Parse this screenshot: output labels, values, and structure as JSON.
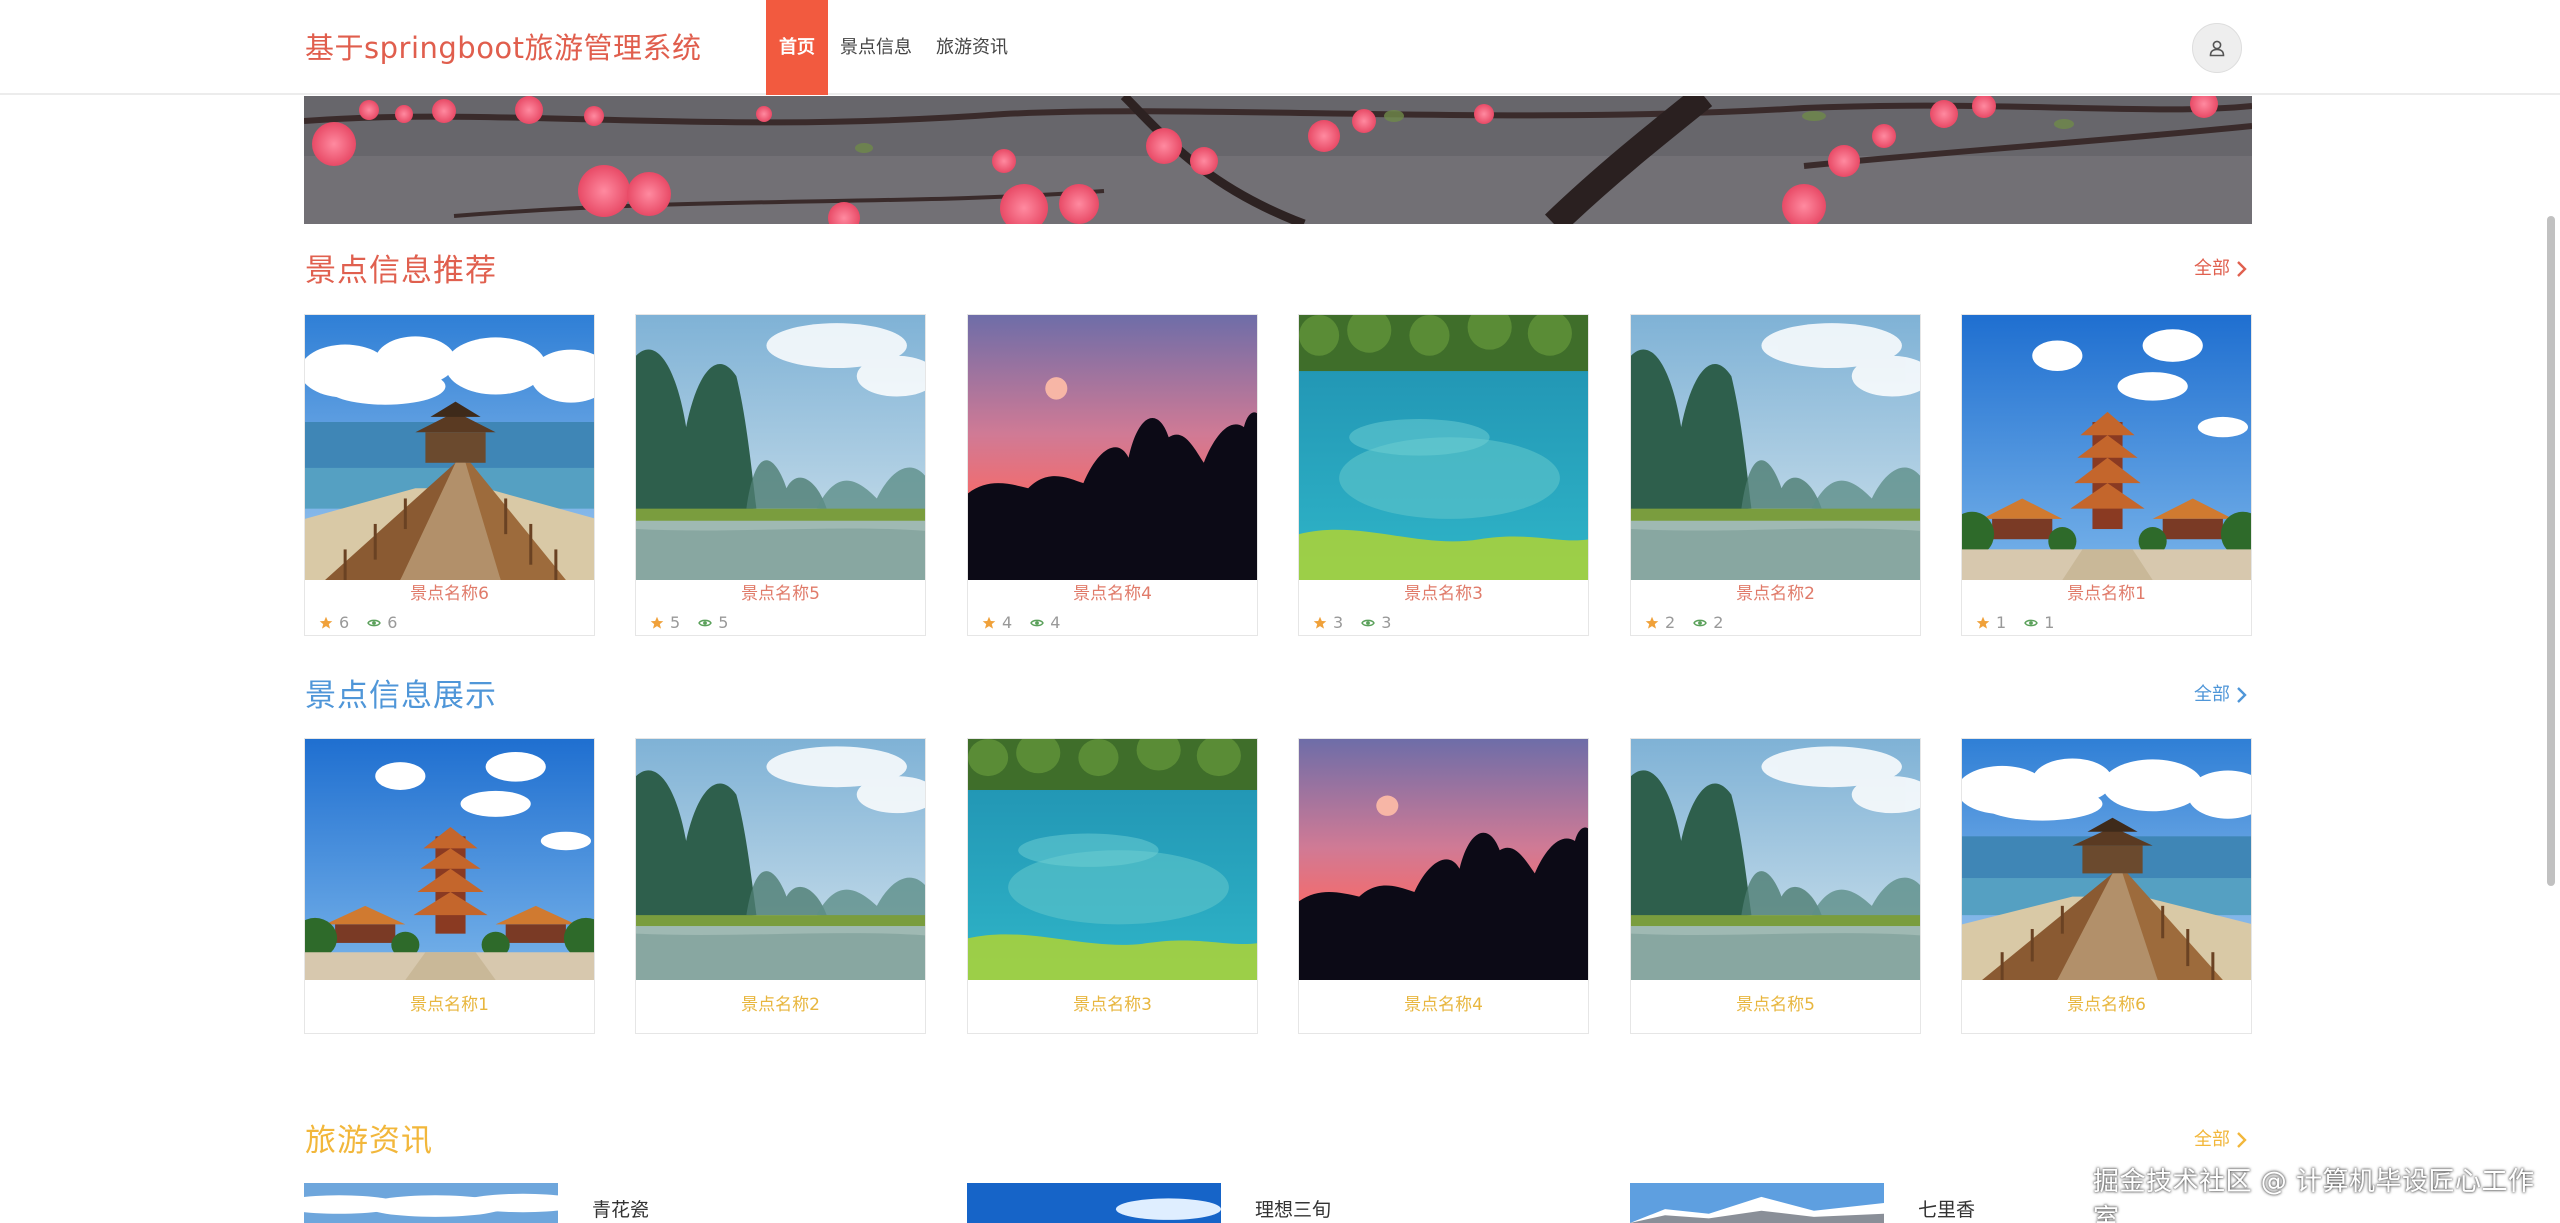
{
  "colors": {
    "brand": "#e05e4d",
    "nav_active_bg": "#f25a3f",
    "section1_title": "#e0604f",
    "section2_title": "#4f96d8",
    "section3_title": "#f2b73b",
    "card1_name": "#e07b6a",
    "card2_name": "#e8b63e",
    "star": "#f0a13a",
    "eye": "#5aa05a"
  },
  "header": {
    "title": "基于springboot旅游管理系统",
    "nav": [
      {
        "label": "首页"
      },
      {
        "label": "景点信息"
      },
      {
        "label": "旅游资讯"
      }
    ],
    "avatar_icon": "user-icon"
  },
  "recommend": {
    "title": "景点信息推荐",
    "more": "全部",
    "items": [
      {
        "name": "景点名称6",
        "stars": "6",
        "views": "6",
        "scene": "pier"
      },
      {
        "name": "景点名称5",
        "stars": "5",
        "views": "5",
        "scene": "karst"
      },
      {
        "name": "景点名称4",
        "stars": "4",
        "views": "4",
        "scene": "sunset"
      },
      {
        "name": "景点名称3",
        "stars": "3",
        "views": "3",
        "scene": "lake"
      },
      {
        "name": "景点名称2",
        "stars": "2",
        "views": "2",
        "scene": "karst"
      },
      {
        "name": "景点名称1",
        "stars": "1",
        "views": "1",
        "scene": "temple"
      }
    ]
  },
  "display": {
    "title": "景点信息展示",
    "more": "全部",
    "items": [
      {
        "name": "景点名称1",
        "scene": "temple"
      },
      {
        "name": "景点名称2",
        "scene": "karst"
      },
      {
        "name": "景点名称3",
        "scene": "lake"
      },
      {
        "name": "景点名称4",
        "scene": "sunset"
      },
      {
        "name": "景点名称5",
        "scene": "karst"
      },
      {
        "name": "景点名称6",
        "scene": "pier"
      }
    ]
  },
  "news": {
    "title": "旅游资讯",
    "more": "全部",
    "items": [
      {
        "title": "青花瓷",
        "scene": "clouds"
      },
      {
        "title": "理想三旬",
        "scene": "sky"
      },
      {
        "title": "七里香",
        "scene": "mountain"
      }
    ]
  },
  "watermark": "掘金技术社区 @ 计算机毕设匠心工作室"
}
